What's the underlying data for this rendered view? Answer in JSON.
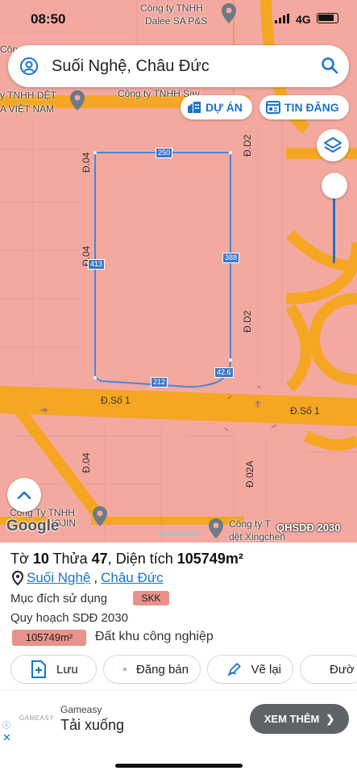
{
  "status_bar": {
    "time": "08:50",
    "network": "4G"
  },
  "search": {
    "value": "Suối Nghệ, Châu Đức"
  },
  "pills": {
    "du_an": "DỰ ÁN",
    "tin_dang": "TIN ĐĂNG"
  },
  "map_labels": {
    "company1_line1": "Công ty TNHH",
    "company1_line2": "Dalee SA P&S",
    "company2": "Công ty TNHH Sav",
    "company3_line1": "y TNHH DỆT",
    "company3_line2": "A VIỆT NAM",
    "company4_line1": "Công Ty TNHH",
    "company4_line2": "NGJIN",
    "company5_line1": "Công ty T",
    "company5_line2": "dệt Xingchen",
    "cong": "Công"
  },
  "roads": {
    "d04_top": "Đ.04",
    "d04_mid": "Đ.04",
    "d04_bottom": "Đ.04",
    "d02_top": "Đ.D2",
    "d02_mid": "Đ.D2",
    "d02a": "Đ.02A",
    "so1_left": "Đ.Số 1",
    "so1_right": "Đ.Số 1"
  },
  "dimensions": {
    "top": "250",
    "right": "388",
    "left": "413",
    "bottom": "212",
    "corner": "42.6"
  },
  "google_logo": "Google",
  "map_layer_tag": "QHSDĐ 2030",
  "parcel": {
    "to_label": "Tờ",
    "to_value": "10",
    "thua_label": "Thửa",
    "thua_value": "47",
    "area_label": "Diện tích",
    "area_value": "105749m²",
    "commune": "Suối Nghệ",
    "district": "Châu Đức",
    "purpose_label": "Mục đích sử dụng",
    "purpose_code": "SKK",
    "plan_label": "Quy hoạch SDĐ 2030",
    "plan_area": "105749m²",
    "plan_text": "Đất khu công nghiệp"
  },
  "actions": [
    "Lưu",
    "Đăng bán",
    "Vẽ lại",
    "Đườ"
  ],
  "ad": {
    "logo": "GAMEASY",
    "sponsor": "Gameasy",
    "title": "Tải xuống",
    "button": "XEM THÊM"
  },
  "colors": {
    "accent": "#1a73c9",
    "map_bg": "#f4a9a0",
    "road": "#f5a623",
    "parcel_line": "#4a86d6",
    "chip": "#e8928a"
  }
}
